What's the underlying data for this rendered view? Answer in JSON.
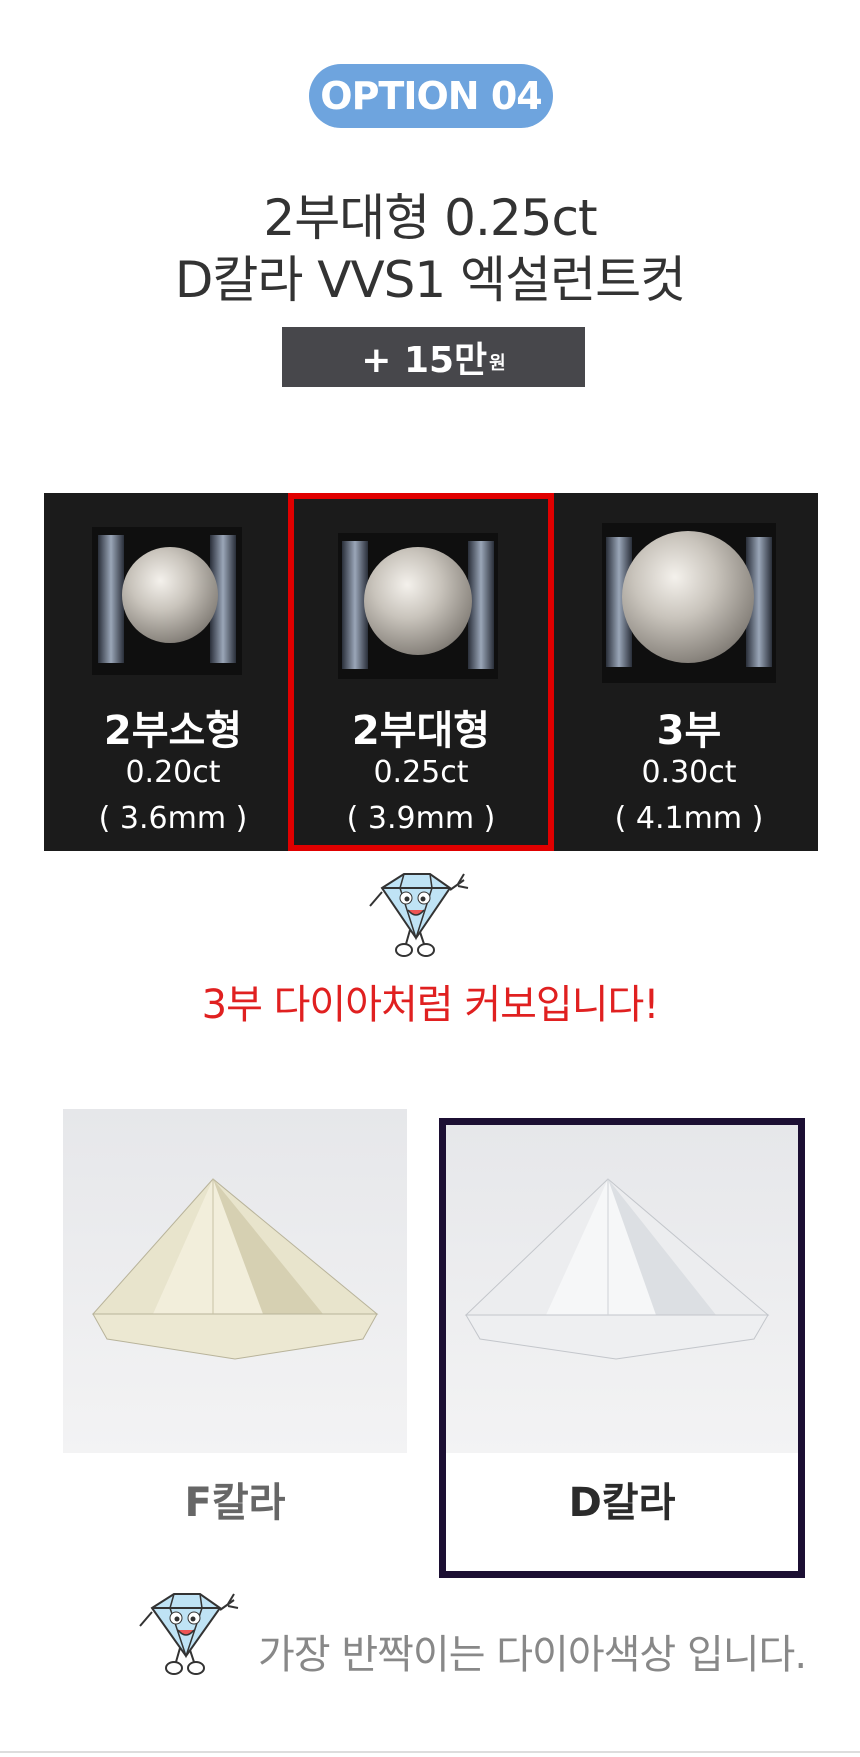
{
  "option_badge": "OPTION 04",
  "title": {
    "line1": "2부대형 0.25ct",
    "line2": "D칼라 VVS1 엑설런트컷"
  },
  "price": {
    "amount": "+ 15만",
    "unit": "원"
  },
  "sizes": [
    {
      "name": "2부소형",
      "carat": "0.20ct",
      "mm": "( 3.6mm )",
      "selected": false
    },
    {
      "name": "2부대형",
      "carat": "0.25ct",
      "mm": "( 3.9mm )",
      "selected": true
    },
    {
      "name": "3부",
      "carat": "0.30ct",
      "mm": "( 4.1mm )",
      "selected": false
    }
  ],
  "tagline": "3부 다이아처럼 커보입니다!",
  "colors": [
    {
      "label": "F칼라",
      "label_color": "#666666",
      "selected": false
    },
    {
      "label": "D칼라",
      "label_color": "#2b2b2b",
      "selected": true
    }
  ],
  "bottom_text": "가장 반짝이는 다이아색상 입니다.",
  "accent_colors": {
    "badge": "#6ea4de",
    "price_bg": "#47474b",
    "selected_border": "#e00000",
    "tagline": "#e02020",
    "d_frame": "#1c0f33"
  },
  "icons": [
    "diamond-mascot-icon"
  ]
}
